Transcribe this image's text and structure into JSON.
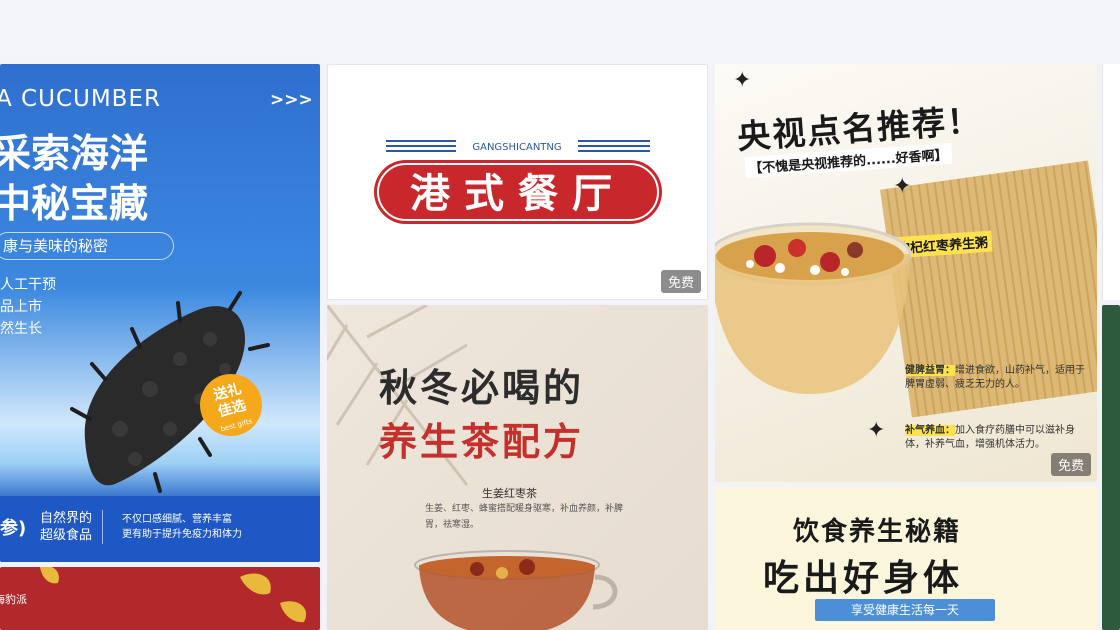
{
  "cards": {
    "seacucumber": {
      "english_title": "A CUCUMBER",
      "arrows": ">>>",
      "title_line1": "采索海洋",
      "title_line2": "中秘宝藏",
      "subtitle": "康与美味的秘密",
      "point1": "人工干预",
      "point2": "品上市",
      "point3": "然生长",
      "gift_line1": "送礼",
      "gift_line2": "佳选",
      "gift_small": "best gifts",
      "footer_a": "参)",
      "footer_b1": "自然界的",
      "footer_b2": "超级食品",
      "footer_c1": "不仅口感细腻、营养丰富",
      "footer_c2": "更有助于提升免疫力和体力"
    },
    "restaurant_logo": {
      "pinyin": "GANGSHICANTNG",
      "name": "港式餐厅",
      "badge": "免费"
    },
    "tea": {
      "headline1": "秋冬必喝的",
      "headline2": "养生茶配方",
      "recipe_name": "生姜红枣茶",
      "recipe_desc": "生姜、红枣、蜂蜜搭配暖身驱寒，补血养颜，补脾胃，祛寒湿。"
    },
    "cctv": {
      "title": "央视点名推荐！",
      "subtitle": "【不愧是央视推荐的......好香啊】",
      "label": "枸杞红枣养生粥",
      "bullet1_head": "健脾益胃：",
      "bullet1_text": "增进食欲，山药补气，适用于脾胃虚弱、疲乏无力的人。",
      "bullet2_head": "补气养血：",
      "bullet2_text": "加入食疗药膳中可以滋补身体，补养气血，增强机体活力。",
      "badge": "免费"
    },
    "diet": {
      "line1": "饮食养生秘籍",
      "line2": "吃出好身体",
      "tagline": "享受健康生活每一天"
    },
    "red": {
      "brand": "海豹派"
    }
  }
}
